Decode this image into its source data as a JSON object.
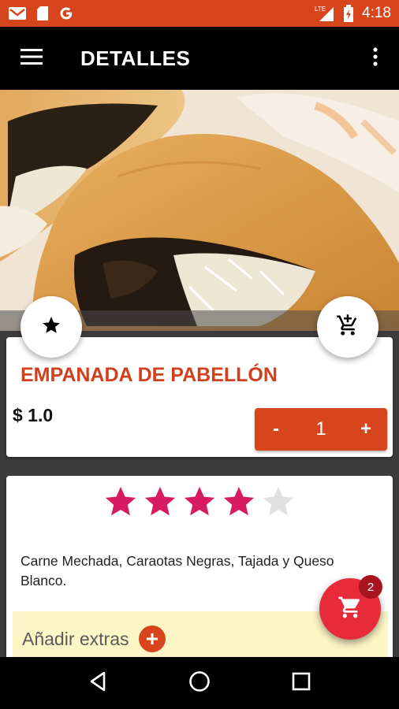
{
  "status_bar": {
    "time": "4:18",
    "network": "LTE",
    "icons": [
      "gmail-icon",
      "sd-card-icon",
      "google-icon",
      "signal-icon",
      "battery-icon"
    ]
  },
  "app_bar": {
    "title": "DETALLES",
    "menu_icon": "hamburger-menu-icon",
    "more_icon": "more-vertical-icon"
  },
  "product": {
    "name": "EMPANADA DE PABELLÓN",
    "price": "$ 1.0",
    "favorite_icon": "star-icon",
    "add_cart_icon": "add-shopping-cart-icon"
  },
  "quantity": {
    "decrement_label": "-",
    "value": "1",
    "increment_label": "+"
  },
  "rating": {
    "value": 4,
    "max": 5,
    "filled_color": "#d81b60",
    "empty_color": "#e0e0e0"
  },
  "description": "Carne Mechada, Caraotas Negras, Tajada y Queso Blanco.",
  "extras": {
    "label": "Añadir extras",
    "add_icon": "plus-icon"
  },
  "cart": {
    "badge_count": "2",
    "icon": "shopping-cart-icon"
  },
  "colors": {
    "primary": "#d6451c",
    "status_bar": "#d6451c",
    "accent": "#e82b3a",
    "rating": "#d81b60",
    "extras_bg": "#fcf6c6"
  }
}
